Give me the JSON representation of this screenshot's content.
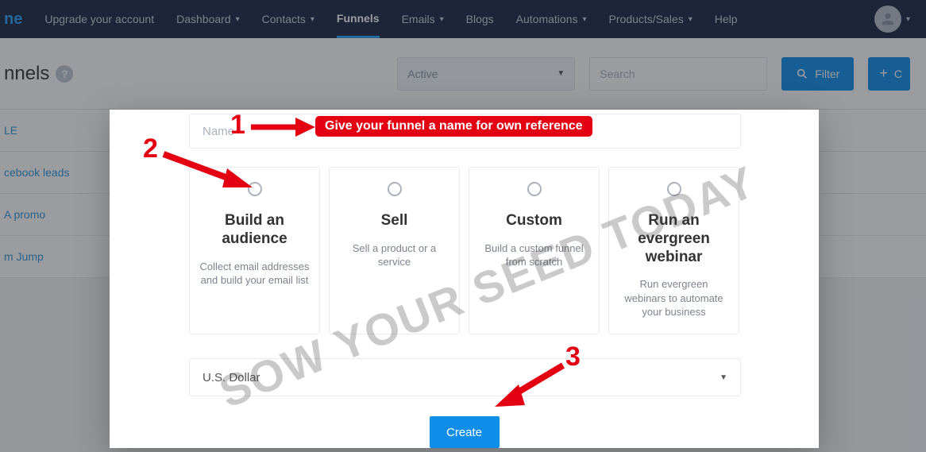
{
  "topnav": {
    "brand": "ne",
    "items": [
      {
        "label": "Upgrade your account",
        "dropdown": false
      },
      {
        "label": "Dashboard",
        "dropdown": true
      },
      {
        "label": "Contacts",
        "dropdown": true
      },
      {
        "label": "Funnels",
        "dropdown": false,
        "active": true
      },
      {
        "label": "Emails",
        "dropdown": true
      },
      {
        "label": "Blogs",
        "dropdown": false
      },
      {
        "label": "Automations",
        "dropdown": true
      },
      {
        "label": "Products/Sales",
        "dropdown": true
      },
      {
        "label": "Help",
        "dropdown": false
      }
    ]
  },
  "subbar": {
    "title": "nnels",
    "status_select": "Active",
    "search_placeholder": "Search",
    "filter_btn": "Filter",
    "create_btn": "C"
  },
  "list": {
    "rows": [
      "LE",
      "cebook leads",
      "A promo",
      "m Jump"
    ]
  },
  "modal": {
    "name_placeholder": "Name",
    "options": [
      {
        "title": "Build an audience",
        "desc": "Collect email addresses and build your email list"
      },
      {
        "title": "Sell",
        "desc": "Sell a product or a service"
      },
      {
        "title": "Custom",
        "desc": "Build a custom funnel from scratch"
      },
      {
        "title": "Run an evergreen webinar",
        "desc": "Run evergreen webinars to automate your business"
      }
    ],
    "currency": "U.S. Dollar",
    "create_btn": "Create"
  },
  "annotations": {
    "tip1": "Give your funnel a name for own reference",
    "num1": "1",
    "num2": "2",
    "num3": "3"
  },
  "watermark": "SOW YOUR SEED TODAY"
}
